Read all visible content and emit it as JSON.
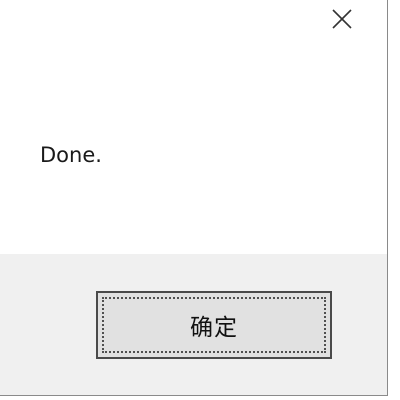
{
  "dialog": {
    "close_icon": "close-icon",
    "message": "Done.",
    "ok_button_label": "确定"
  },
  "colors": {
    "content_background": "#ffffff",
    "footer_background": "#f0f0f0",
    "button_face": "#e1e1e1",
    "button_border": "#4a4a4a",
    "text": "#1a1a1a"
  }
}
